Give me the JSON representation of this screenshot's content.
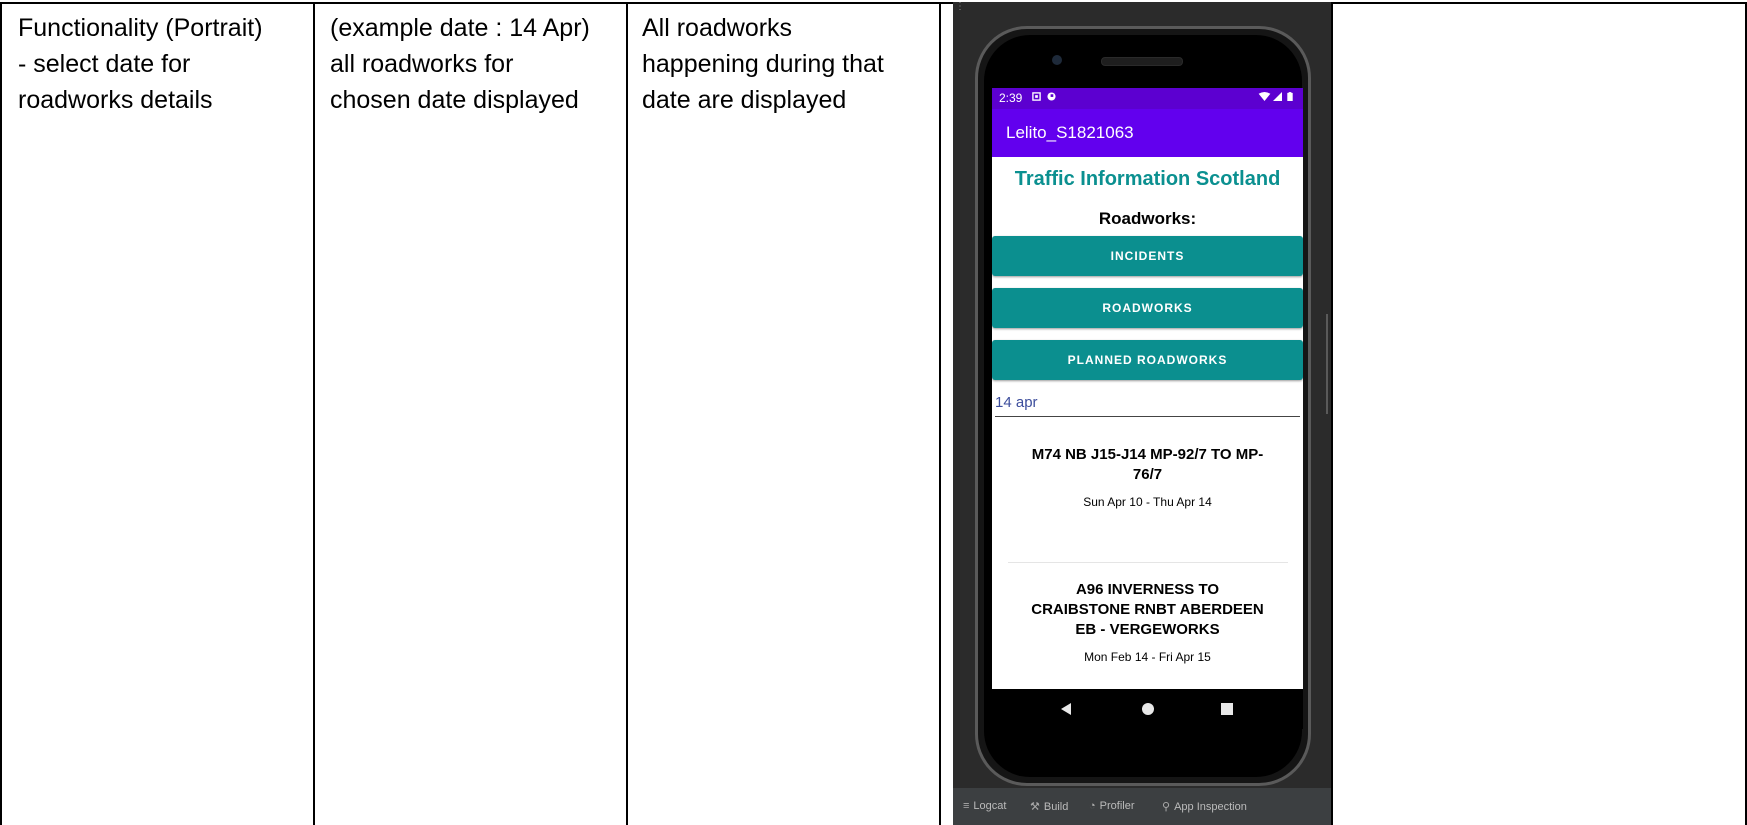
{
  "table": {
    "col1": "Functionality (Portrait)\n- select date for\nroadworks details",
    "col2": "(example date : 14 Apr)\nall roadworks for\nchosen date displayed",
    "col3": "All roadworks\nhappening during that\ndate are displayed",
    "col5": ""
  },
  "phone": {
    "status_time": "2:39",
    "status_icons": [
      "notification-icon",
      "app-icon",
      "wifi-icon",
      "signal-icon",
      "battery-icon"
    ],
    "app_title": "Lelito_S1821063",
    "heading": "Traffic Information Scotland",
    "subheading": "Roadworks:",
    "buttons": {
      "incidents": "INCIDENTS",
      "roadworks": "ROADWORKS",
      "planned": "PLANNED ROADWORKS"
    },
    "date_value": "14 apr",
    "roadworks": [
      {
        "title": "M74 NB J15-J14 MP-92/7 TO MP-76/7",
        "dates": "Sun Apr 10 - Thu Apr 14"
      },
      {
        "title": "A96 INVERNESS TO CRAIBSTONE RNBT ABERDEEN EB - VERGEWORKS",
        "dates": "Mon Feb 14 - Fri Apr 15"
      }
    ]
  },
  "ide": {
    "tools": [
      "Logcat",
      "Build",
      "Profiler",
      "App Inspection"
    ]
  },
  "colors": {
    "status_bar": "#5c00d0",
    "app_bar": "#6200ee",
    "accent_teal": "#0b8f8f",
    "heading_teal": "#0b9090",
    "date_text": "#3c4d9c",
    "ide_bg": "#3c3f41"
  }
}
